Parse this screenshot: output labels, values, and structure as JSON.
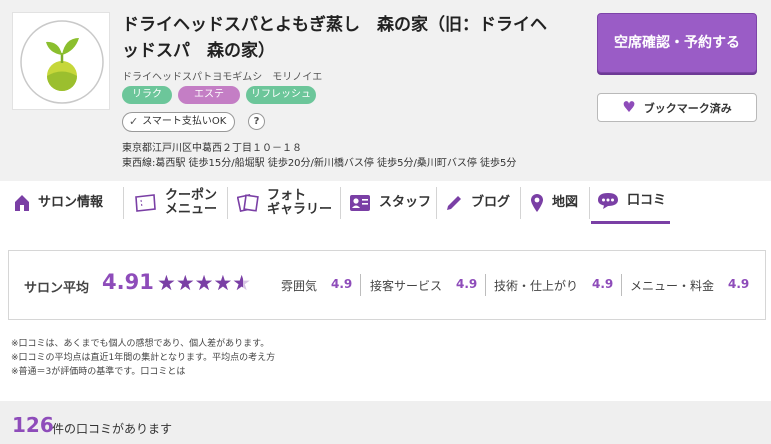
{
  "salon": {
    "name": "ドライヘッドスパとよもぎ蒸し　森の家（旧：ドライヘッドスパ　森の家）",
    "name_line1": "ドライヘッドスパとよもぎ蒸し　森の家（旧：ドライヘ",
    "name_line2": "ッドスパ　森の家）",
    "kana": "ドライヘッドスパトヨモギムシ　モリノイエ",
    "tags": [
      "リラク",
      "エステ",
      "リフレッシュ"
    ],
    "smart_pay": "スマート支払いOK",
    "help": "?",
    "address": "東京都江戸川区中葛西２丁目１０－１８",
    "access": "東西線:葛西駅 徒歩15分/船堀駅 徒歩20分/新川橋バス停 徒歩5分/桑川町バス停 徒歩5分"
  },
  "actions": {
    "reserve": "空席確認・予約する",
    "bookmark": "ブックマーク済み"
  },
  "nav": {
    "salon_info": "サロン情報",
    "coupon_1": "クーポン",
    "coupon_2": "メニュー",
    "photo_1": "フォト",
    "photo_2": "ギャラリー",
    "staff": "スタッフ",
    "blog": "ブログ",
    "map": "地図",
    "reviews": "口コミ"
  },
  "rating": {
    "label": "サロン平均",
    "score": "4.91",
    "stars": "★★★★★",
    "star_fraction": 0.91,
    "sub": [
      {
        "label": "雰囲気",
        "value": "4.9"
      },
      {
        "label": "接客サービス",
        "value": "4.9"
      },
      {
        "label": "技術・仕上がり",
        "value": "4.9"
      },
      {
        "label": "メニュー・料金",
        "value": "4.9"
      }
    ]
  },
  "notes": {
    "line1": "※口コミは、あくまでも個人の感想であり、個人差があります。",
    "line2": "※口コミの平均点は直近1年間の集計となります。平均点の考え方",
    "line3": "※普通＝3が評価時の基準です。口コミとは"
  },
  "review_count": {
    "number": "126",
    "suffix": "件の口コミがあります"
  },
  "colors": {
    "accent": "#8e4cba",
    "reserve_bg": "#9a5cc6",
    "tag_green": "#6cc69a",
    "tag_pink": "#c47ec5"
  }
}
